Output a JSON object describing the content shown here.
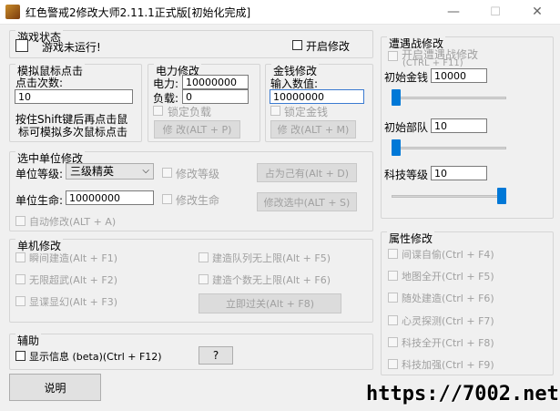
{
  "window": {
    "title": "红色警戒2修改大师2.11.1正式版[初始化完成]",
    "controls": {
      "minimize": "—",
      "maximize": "☐",
      "close": "✕"
    }
  },
  "game_status": {
    "title": "游戏状态",
    "status_text": "游戏未运行!",
    "enable_label": "开启修改"
  },
  "mouse_click": {
    "title": "模拟鼠标点击",
    "count_label": "点击次数:",
    "count_value": "10",
    "hint_line1": "按住Shift键后再点击鼠",
    "hint_line2": "标可模拟多次鼠标点击"
  },
  "power": {
    "title": "电力修改",
    "power_label": "电力:",
    "power_value": "10000000",
    "load_label": "负载:",
    "load_value": "0",
    "lock_label": "锁定负载",
    "apply_label": "修 改(ALT + P)"
  },
  "money": {
    "title": "金钱修改",
    "input_label": "输入数值:",
    "input_value": "10000000",
    "lock_label": "锁定金钱",
    "apply_label": "修 改(ALT + M)"
  },
  "unit": {
    "title": "选中单位修改",
    "level_label": "单位等级:",
    "level_value": "三级精英",
    "modify_level_label": "修改等级",
    "own_label": "占为己有(Alt + D)",
    "life_label": "单位生命:",
    "life_value": "10000000",
    "modify_life_label": "修改生命",
    "modify_selected_label": "修改选中(ALT + S)",
    "auto_label": "自动修改(ALT + A)"
  },
  "single": {
    "title": "单机修改",
    "instant_build": "瞬间建造(Alt + F1)",
    "unlimited_super": "无限超武(Alt + F2)",
    "show_hidden": "显谍显幻(Alt + F3)",
    "unlimited_queue": "建造队列无上限(Alt + F5)",
    "unlimited_count": "建造个数无上限(Alt + F6)",
    "instant_win": "立即过关(Alt + F8)"
  },
  "aux": {
    "title": "辅助",
    "show_info": "显示信息 (beta)(Ctrl + F12)",
    "help_q": "?"
  },
  "explain_button": "说明",
  "encounter": {
    "title": "遭遇战修改",
    "enable_line1": "开启遭遇战修改",
    "enable_line2": "(CTRL + F11)",
    "money_label": "初始金钱",
    "money_value": "10000",
    "troops_label": "初始部队",
    "troops_value": "10",
    "tech_label": "科技等级",
    "tech_value": "10",
    "money_slider": 0.0,
    "troops_slider": 0.0,
    "tech_slider": 1.0
  },
  "attributes": {
    "title": "属性修改",
    "items": [
      "间谍自偷(Ctrl + F4)",
      "地图全开(Ctrl + F5)",
      "随处建造(Ctrl + F6)",
      "心灵探测(Ctrl + F7)",
      "科技全开(Ctrl + F8)",
      "科技加强(Ctrl + F9)"
    ]
  },
  "watermark": "https://7002.net",
  "colors": {
    "accent": "#0078d7",
    "disabled_text": "#a0a0a0"
  }
}
